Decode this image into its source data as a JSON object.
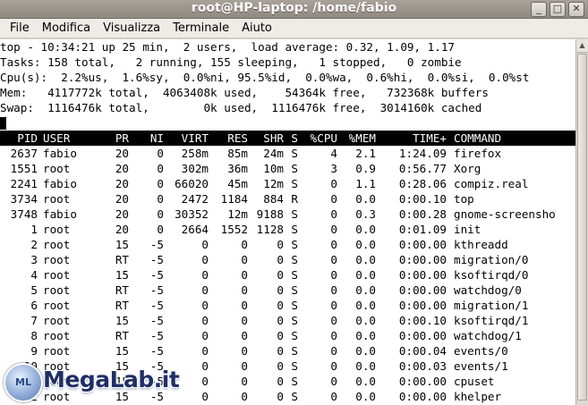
{
  "window": {
    "title": "root@HP-laptop: /home/fabio",
    "controls": {
      "minimize": "_",
      "maximize": "□",
      "close": "✕"
    }
  },
  "menu": {
    "items": [
      "File",
      "Modifica",
      "Visualizza",
      "Terminale",
      "Aiuto"
    ]
  },
  "top": {
    "summary": [
      "top - 10:34:21 up 25 min,  2 users,  load average: 0.32, 1.09, 1.17",
      "Tasks: 158 total,   2 running, 155 sleeping,   1 stopped,   0 zombie",
      "Cpu(s):  2.2%us,  1.6%sy,  0.0%ni, 95.5%id,  0.0%wa,  0.6%hi,  0.0%si,  0.0%st",
      "Mem:   4117772k total,  4063408k used,    54364k free,   732368k buffers",
      "Swap:  1116476k total,        0k used,  1116476k free,  3014160k cached"
    ],
    "columns": [
      "PID",
      "USER",
      "PR",
      "NI",
      "VIRT",
      "RES",
      "SHR",
      "S",
      "%CPU",
      "%MEM",
      "TIME+",
      "COMMAND"
    ],
    "processes": [
      [
        "2637",
        "fabio",
        "20",
        "0",
        "258m",
        "85m",
        "24m",
        "S",
        "4",
        "2.1",
        "1:24.09",
        "firefox"
      ],
      [
        "1551",
        "root",
        "20",
        "0",
        "302m",
        "36m",
        "10m",
        "S",
        "3",
        "0.9",
        "0:56.77",
        "Xorg"
      ],
      [
        "2241",
        "fabio",
        "20",
        "0",
        "66020",
        "45m",
        "12m",
        "S",
        "0",
        "1.1",
        "0:28.06",
        "compiz.real"
      ],
      [
        "3734",
        "root",
        "20",
        "0",
        "2472",
        "1184",
        "884",
        "R",
        "0",
        "0.0",
        "0:00.10",
        "top"
      ],
      [
        "3748",
        "fabio",
        "20",
        "0",
        "30352",
        "12m",
        "9188",
        "S",
        "0",
        "0.3",
        "0:00.28",
        "gnome-screensho"
      ],
      [
        "1",
        "root",
        "20",
        "0",
        "2664",
        "1552",
        "1128",
        "S",
        "0",
        "0.0",
        "0:01.09",
        "init"
      ],
      [
        "2",
        "root",
        "15",
        "-5",
        "0",
        "0",
        "0",
        "S",
        "0",
        "0.0",
        "0:00.00",
        "kthreadd"
      ],
      [
        "3",
        "root",
        "RT",
        "-5",
        "0",
        "0",
        "0",
        "S",
        "0",
        "0.0",
        "0:00.00",
        "migration/0"
      ],
      [
        "4",
        "root",
        "15",
        "-5",
        "0",
        "0",
        "0",
        "S",
        "0",
        "0.0",
        "0:00.00",
        "ksoftirqd/0"
      ],
      [
        "5",
        "root",
        "RT",
        "-5",
        "0",
        "0",
        "0",
        "S",
        "0",
        "0.0",
        "0:00.00",
        "watchdog/0"
      ],
      [
        "6",
        "root",
        "RT",
        "-5",
        "0",
        "0",
        "0",
        "S",
        "0",
        "0.0",
        "0:00.00",
        "migration/1"
      ],
      [
        "7",
        "root",
        "15",
        "-5",
        "0",
        "0",
        "0",
        "S",
        "0",
        "0.0",
        "0:00.10",
        "ksoftirqd/1"
      ],
      [
        "8",
        "root",
        "RT",
        "-5",
        "0",
        "0",
        "0",
        "S",
        "0",
        "0.0",
        "0:00.00",
        "watchdog/1"
      ],
      [
        "9",
        "root",
        "15",
        "-5",
        "0",
        "0",
        "0",
        "S",
        "0",
        "0.0",
        "0:00.04",
        "events/0"
      ],
      [
        "10",
        "root",
        "15",
        "-5",
        "0",
        "0",
        "0",
        "S",
        "0",
        "0.0",
        "0:00.03",
        "events/1"
      ],
      [
        "11",
        "root",
        "15",
        "-5",
        "0",
        "0",
        "0",
        "S",
        "0",
        "0.0",
        "0:00.00",
        "cpuset"
      ],
      [
        "12",
        "root",
        "15",
        "-5",
        "0",
        "0",
        "0",
        "S",
        "0",
        "0.0",
        "0:00.00",
        "khelper"
      ]
    ]
  },
  "watermark": {
    "badge": "ML",
    "text": "MegaLab.it"
  },
  "colors": {
    "terminal_bg": "#ffffff",
    "terminal_fg": "#000000",
    "header_bg": "#000000",
    "header_fg": "#ffffff",
    "titlebar": "#9a948c",
    "menubar": "#efebe7"
  }
}
